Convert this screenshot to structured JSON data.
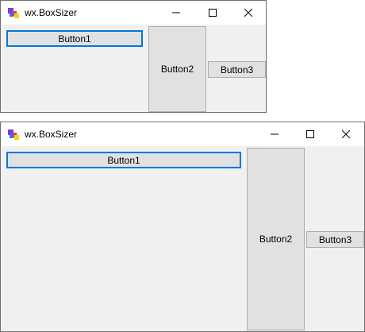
{
  "windows": [
    {
      "title": "wx.BoxSizer",
      "buttons": [
        "Button1",
        "Button2",
        "Button3"
      ]
    },
    {
      "title": "wx.BoxSizer",
      "buttons": [
        "Button1",
        "Button2",
        "Button3"
      ]
    }
  ],
  "icons": {
    "app": "wxpython-app-icon",
    "minimize": "minimize-icon",
    "maximize": "maximize-icon",
    "close": "close-icon"
  },
  "colors": {
    "focus_border": "#0078d7",
    "button_face": "#e1e1e1",
    "client_bg": "#f0f0f0"
  }
}
